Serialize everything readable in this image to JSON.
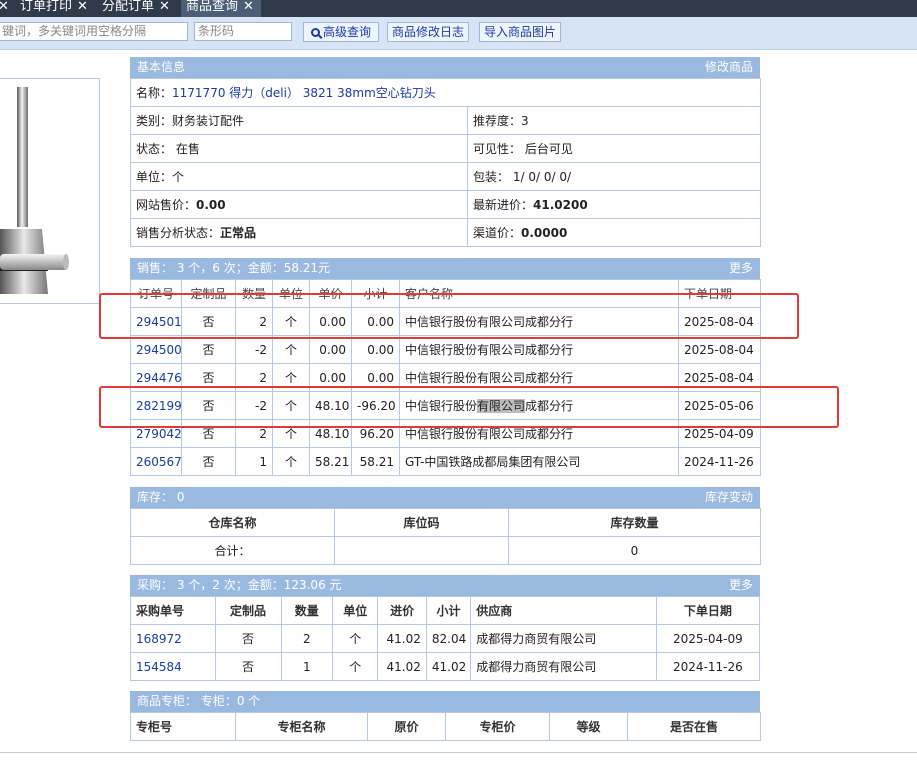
{
  "tabs": [
    {
      "label": "订单打印",
      "close": "✕"
    },
    {
      "label": "分配订单",
      "close": "✕"
    },
    {
      "label": "商品查询",
      "close": "✕"
    }
  ],
  "toolbar": {
    "keyword_placeholder": "键词，多关键词用空格分隔",
    "barcode_placeholder": "条形码",
    "advanced_search": "高级查询",
    "modify_log": "商品修改日志",
    "import_images": "导入商品图片"
  },
  "basic": {
    "title": "基本信息",
    "edit": "修改商品",
    "name_label": "名称：",
    "name_value": "1171770 得力（deli） 3821 38mm空心钻刀头",
    "category_label": "类别：",
    "category_value": "财务装订配件",
    "recommend_label": "推荐度：",
    "recommend_value": "3",
    "status_label": "状态：",
    "status_value": "在售",
    "visibility_label": "可见性：",
    "visibility_value": "后台可见",
    "unit_label": "单位：",
    "unit_value": "个",
    "packing_label": "包装：",
    "packing_value": "1/ 0/ 0/ 0/",
    "web_price_label": "网站售价：",
    "web_price_value": "0.00",
    "latest_cost_label": "最新进价：",
    "latest_cost_value": "41.0200",
    "analysis_label": "销售分析状态：",
    "analysis_value": "正常品",
    "channel_price_label": "渠道价：",
    "channel_price_value": "0.0000"
  },
  "sales": {
    "title": "销售： 3 个，6 次；金额：58.21元",
    "more": "更多",
    "columns": [
      "订单号",
      "定制品",
      "数量",
      "单位",
      "单价",
      "小计",
      "客户名称",
      "下单日期"
    ],
    "rows": [
      {
        "order": "294501",
        "custom": "否",
        "qty": "2",
        "unit": "个",
        "price": "0.00",
        "subtotal": "0.00",
        "customer": "中信银行股份有限公司成都分行",
        "date": "2025-08-04"
      },
      {
        "order": "294500",
        "custom": "否",
        "qty": "-2",
        "unit": "个",
        "price": "0.00",
        "subtotal": "0.00",
        "customer": "中信银行股份有限公司成都分行",
        "date": "2025-08-04"
      },
      {
        "order": "294476",
        "custom": "否",
        "qty": "2",
        "unit": "个",
        "price": "0.00",
        "subtotal": "0.00",
        "customer": "中信银行股份有限公司成都分行",
        "date": "2025-08-04"
      },
      {
        "order": "282199",
        "custom": "否",
        "qty": "-2",
        "unit": "个",
        "price": "48.10",
        "subtotal": "-96.20",
        "customer_pre": "中信银行股份",
        "customer_sel": "有限公司",
        "customer_post": "成都分行",
        "date": "2025-05-06"
      },
      {
        "order": "279042",
        "custom": "否",
        "qty": "2",
        "unit": "个",
        "price": "48.10",
        "subtotal": "96.20",
        "customer": "中信银行股份有限公司成都分行",
        "date": "2025-04-09"
      },
      {
        "order": "260567",
        "custom": "否",
        "qty": "1",
        "unit": "个",
        "price": "58.21",
        "subtotal": "58.21",
        "customer": "GT-中国铁路成都局集团有限公司",
        "date": "2024-11-26"
      }
    ]
  },
  "stock": {
    "title": "库存： 0",
    "change": "库存变动",
    "columns": [
      "仓库名称",
      "库位码",
      "库存数量"
    ],
    "total_label": "合计：",
    "total_qty": "0"
  },
  "purchase": {
    "title": "采购： 3 个，2 次；金额：123.06 元",
    "more": "更多",
    "columns": [
      "采购单号",
      "定制品",
      "数量",
      "单位",
      "进价",
      "小计",
      "供应商",
      "下单日期"
    ],
    "rows": [
      {
        "order": "168972",
        "custom": "否",
        "qty": "2",
        "unit": "个",
        "price": "41.02",
        "subtotal": "82.04",
        "supplier": "成都得力商贸有限公司",
        "date": "2025-04-09"
      },
      {
        "order": "154584",
        "custom": "否",
        "qty": "1",
        "unit": "个",
        "price": "41.02",
        "subtotal": "41.02",
        "supplier": "成都得力商贸有限公司",
        "date": "2024-11-26"
      }
    ]
  },
  "counter": {
    "title": "商品专柜： 专柜：0 个",
    "columns": [
      "专柜号",
      "专柜名称",
      "原价",
      "专柜价",
      "等级",
      "是否在售"
    ]
  },
  "colors": {
    "header_bg": "#9ab9e0",
    "toolbar_bg": "#d7e4f5",
    "tabbar_bg": "#2f3a4a",
    "highlight": "#e53935",
    "link": "#1a3aa6"
  }
}
